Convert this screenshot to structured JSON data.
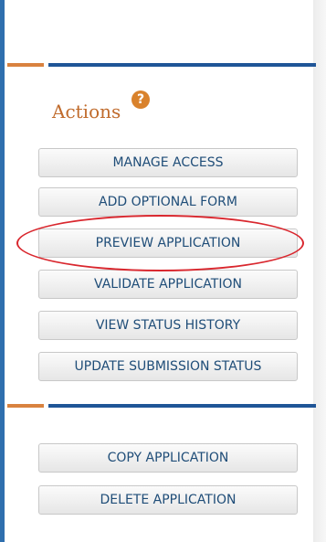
{
  "actions": {
    "title": "Actions",
    "help_glyph": "?",
    "help_icon_name": "help-icon",
    "buttons": [
      "MANAGE ACCESS",
      "ADD OPTIONAL FORM",
      "PREVIEW APPLICATION",
      "VALIDATE APPLICATION",
      "VIEW STATUS HISTORY",
      "UPDATE SUBMISSION STATUS"
    ]
  },
  "secondary": {
    "buttons": [
      "COPY APPLICATION",
      "DELETE APPLICATION"
    ]
  },
  "colors": {
    "accent_orange": "#d9823f",
    "accent_blue": "#1f5597",
    "title_color": "#c06b2c",
    "button_text": "#1f4d78",
    "highlight_red": "#d9272e"
  }
}
